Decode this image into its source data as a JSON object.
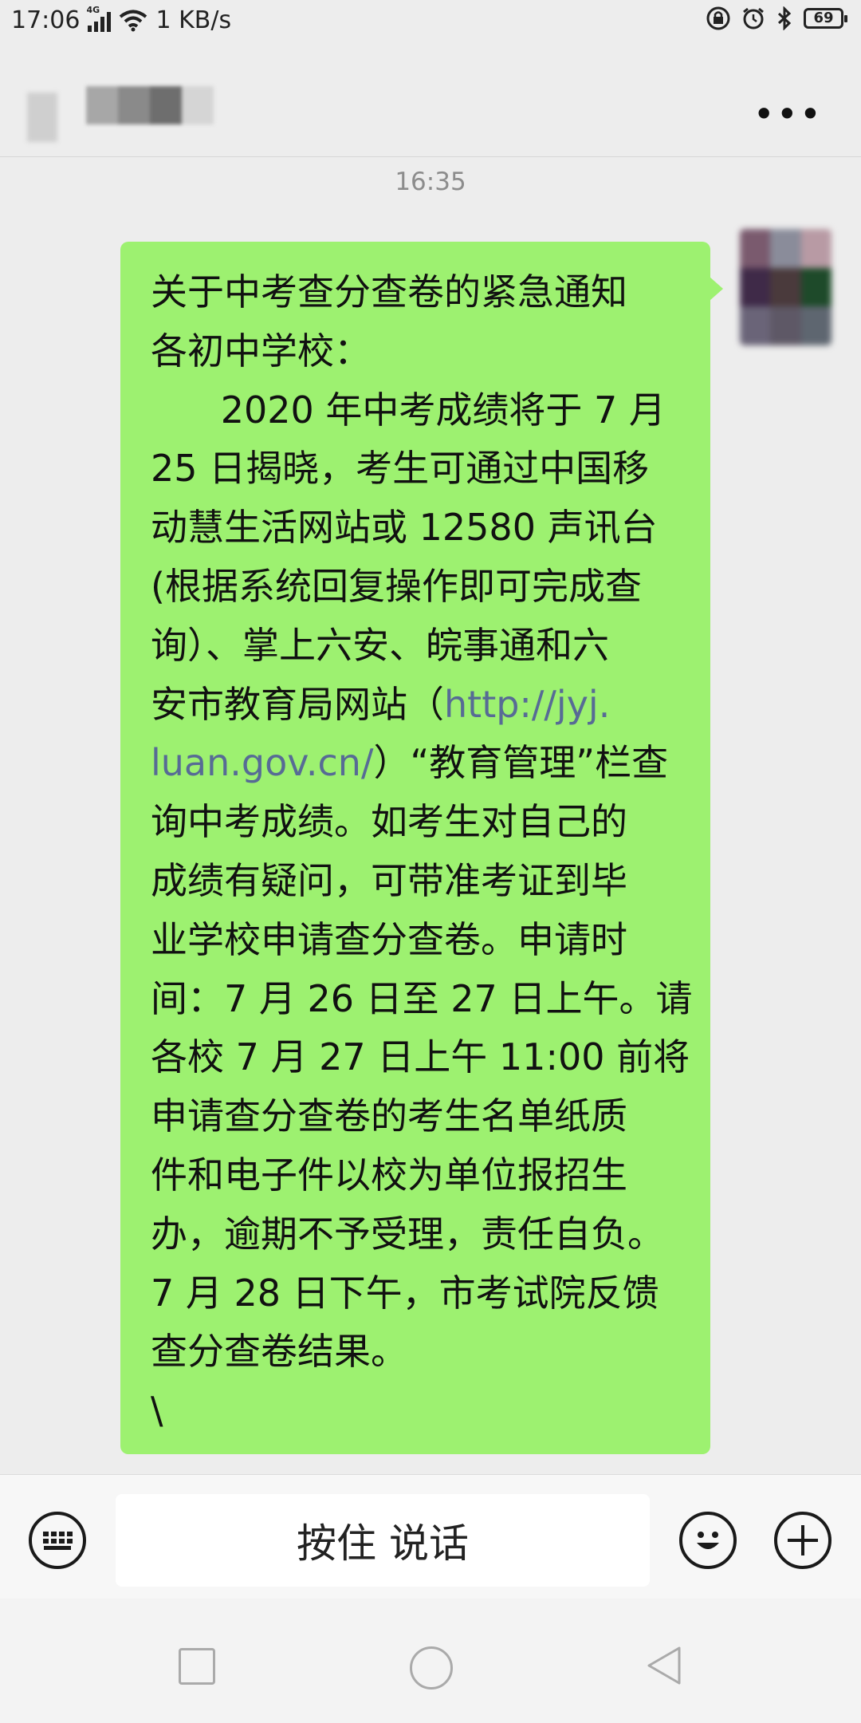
{
  "status_bar": {
    "time": "17:06",
    "network_type": "4G",
    "speed": "1 KB/s",
    "battery": "69",
    "icons": [
      "signal-icon",
      "wifi-icon",
      "lock-icon",
      "alarm-icon",
      "bluetooth-icon",
      "battery-icon"
    ]
  },
  "title_bar": {
    "more_label": "•••"
  },
  "chat": {
    "timestamp": "16:35",
    "message": {
      "lines": [
        "关于中考查分查卷的紧急通知",
        "各初中学校：",
        "      2020 年中考成绩将于 7 月",
        "25 日揭晓，考生可通过中国移",
        "动慧生活网站或 12580 声讯台",
        "(根据系统回复操作即可完成查",
        "询）、掌上六安、皖事通和六",
        "安市教育局网站（",
        "）“教育管理”栏查",
        "询中考成绩。如考生对自己的",
        "成绩有疑问，可带准考证到毕",
        "业学校申请查分查卷。申请时",
        "间：7 月 26 日至 27 日上午。请",
        "各校 7 月 27 日上午 11:00 前将",
        "申请查分查卷的考生名单纸质",
        "件和电子件以校为单位报招生",
        "办，逾期不予受理，责任自负。",
        "7 月 28 日下午，市考试院反馈",
        "查分查卷结果。",
        "\\"
      ],
      "link_part1": "http://jyj.",
      "link_part2": "luan.gov.cn/"
    }
  },
  "input_bar": {
    "talk_label": "按住 说话",
    "icons": [
      "keyboard-icon",
      "emoji-icon",
      "plus-icon"
    ]
  },
  "nav_bar": {
    "icons": [
      "recent-apps-icon",
      "home-icon",
      "back-icon"
    ]
  },
  "colors": {
    "bubble": "#9df170",
    "link": "#576b95",
    "background": "#ededed"
  }
}
